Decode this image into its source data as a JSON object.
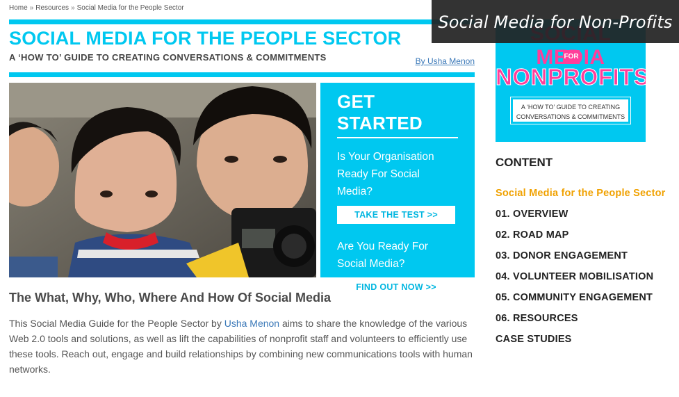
{
  "breadcrumb": {
    "home": "Home",
    "resources": "Resources",
    "current": "Social Media for the People Sector",
    "separator": "»"
  },
  "header": {
    "title": "SOCIAL MEDIA FOR THE PEOPLE SECTOR",
    "subtitle": "A ‘HOW TO’ GUIDE TO CREATING CONVERSATIONS & COMMITMENTS",
    "byline": "By Usha Menon"
  },
  "cta": {
    "title": "GET STARTED",
    "q1": "Is Your Organisation Ready For Social Media?",
    "btn1": "TAKE THE TEST >>",
    "q2": "Are You Ready For Social Media?",
    "btn2": "FIND OUT NOW >>"
  },
  "article": {
    "heading": "The What, Why, Who, Where And How Of Social Media",
    "body_pre": "This Social Media Guide for the People Sector by ",
    "author_link": "Usha Menon",
    "body_post": " aims to share the knowledge of the various Web 2.0 tools and solutions, as well as lift the capabilities of nonprofit staff and volunteers to efficiently use these tools. Reach out, engage and build relationships by combining new communications tools with human networks."
  },
  "book": {
    "line1": "SOCIAL MEDIA",
    "for": "FOR",
    "line2": "NONPROFITS",
    "tagline1": "A ‘HOW TO’ GUIDE TO CREATING",
    "tagline2": "CONVERSATIONS & COMMITMENTS"
  },
  "overlay": {
    "caption": "Social Media for Non-Profits"
  },
  "toc": {
    "heading": "CONTENT",
    "items": [
      {
        "label": "Social Media for the People Sector",
        "active": true
      },
      {
        "label": "01. OVERVIEW"
      },
      {
        "label": "02. ROAD MAP"
      },
      {
        "label": "03. DONOR ENGAGEMENT"
      },
      {
        "label": "04. VOLUNTEER MOBILISATION"
      },
      {
        "label": "05. COMMUNITY ENGAGEMENT"
      },
      {
        "label": "06. RESOURCES"
      },
      {
        "label": "CASE STUDIES"
      }
    ]
  },
  "colors": {
    "accent": "#00c8f0",
    "pink": "#ff3e9a",
    "active_link": "#f0a100",
    "link": "#3a78b8"
  }
}
